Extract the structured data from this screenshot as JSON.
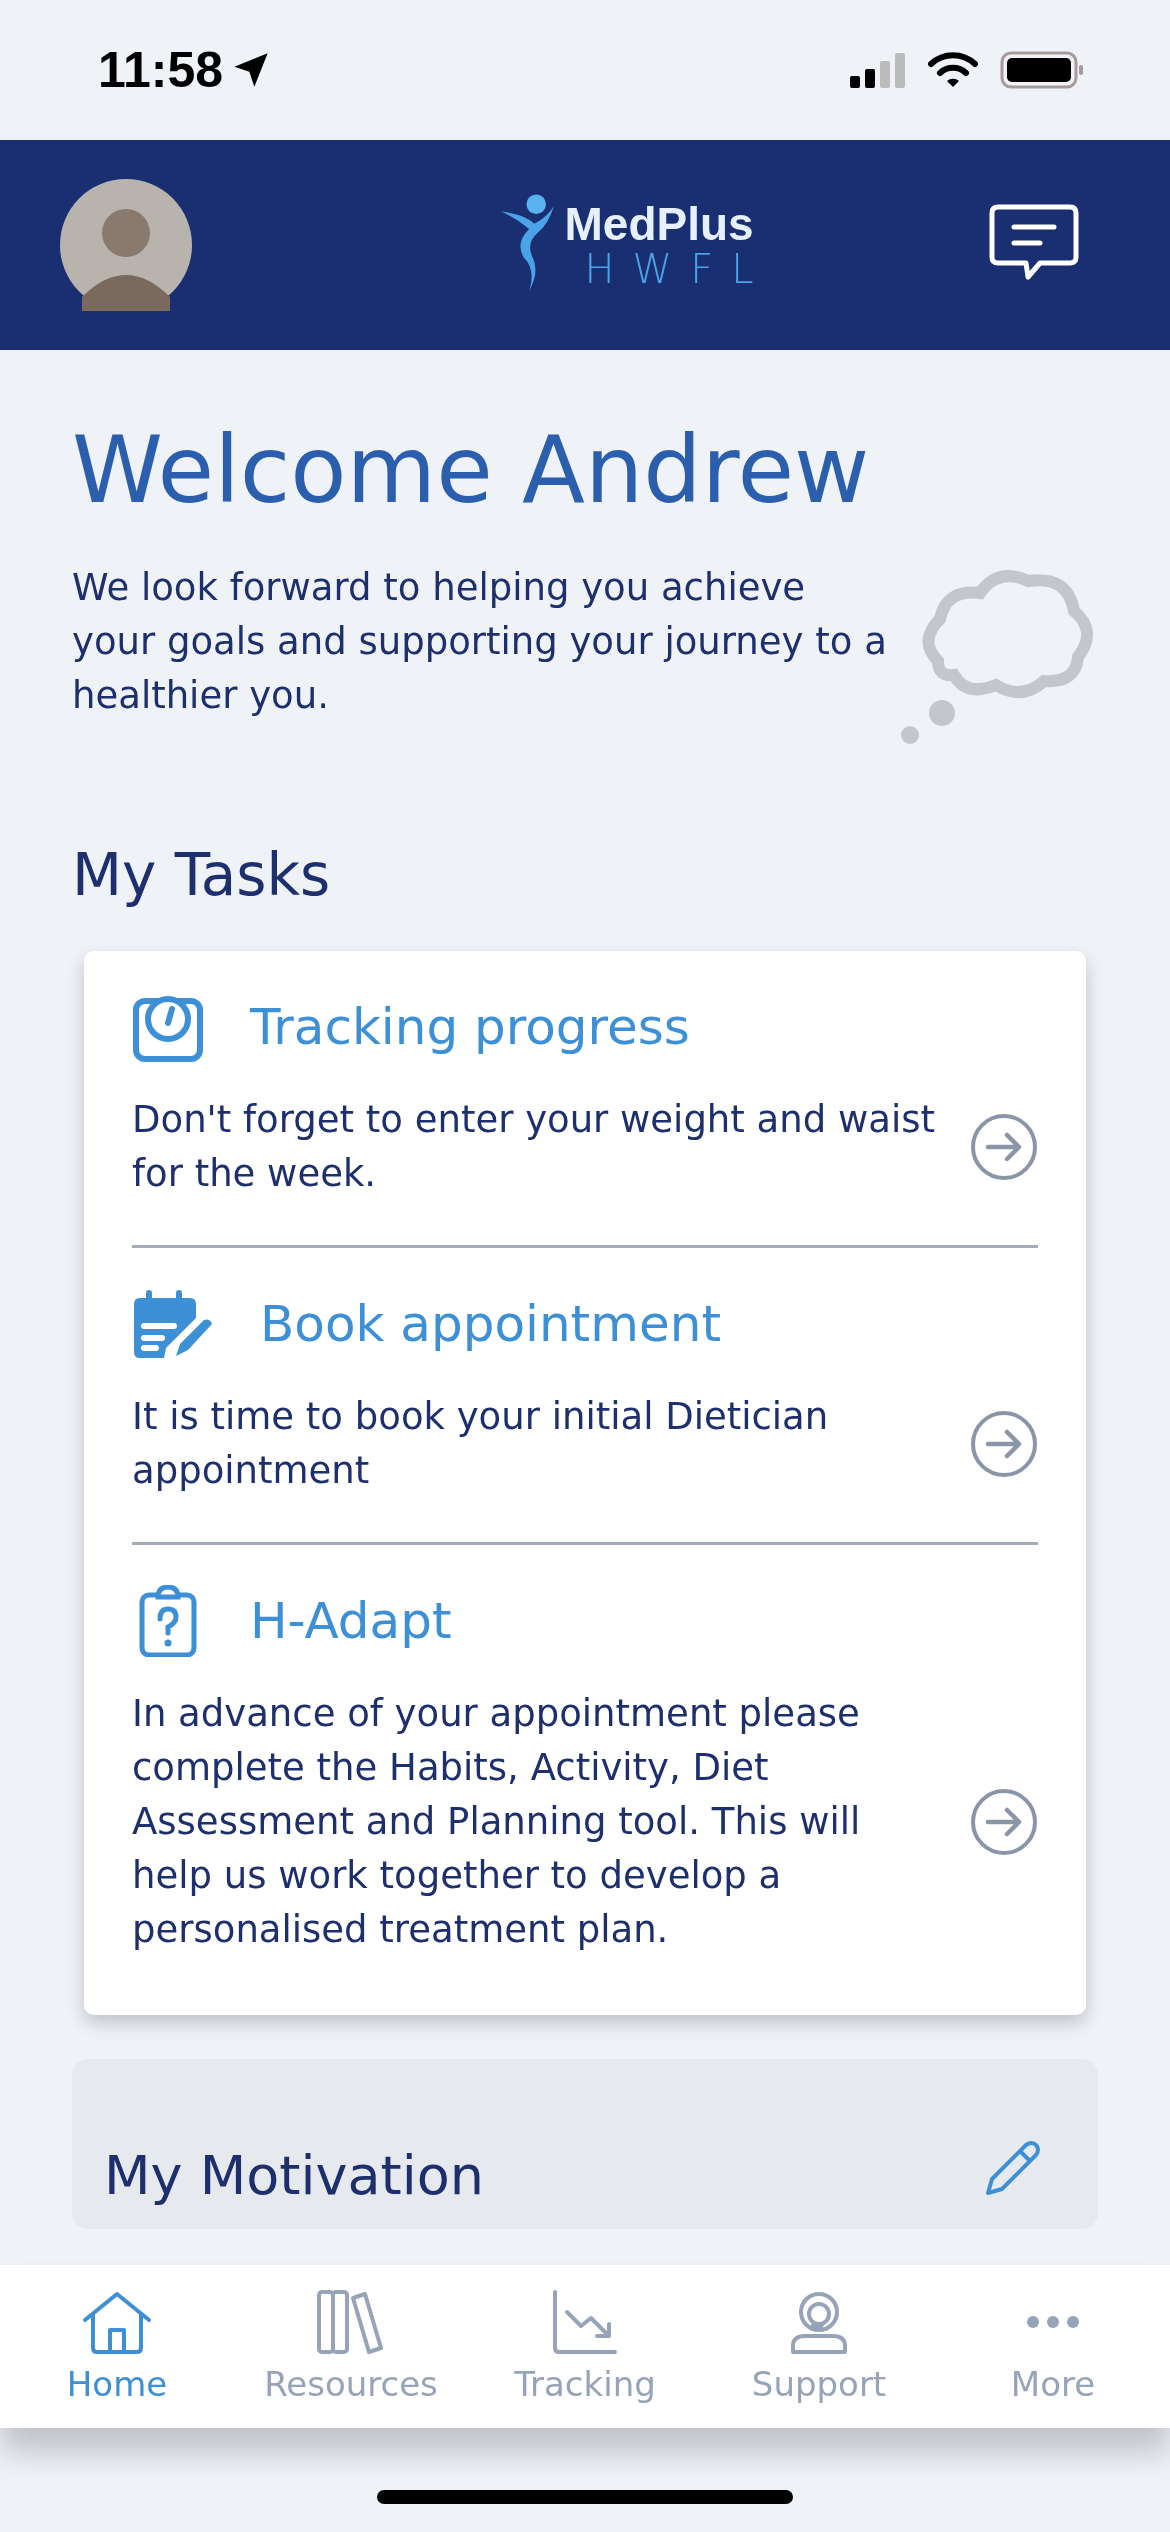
{
  "status_bar": {
    "time": "11:58"
  },
  "header": {
    "logo": {
      "name": "MedPlus",
      "sub": "HWFL"
    }
  },
  "welcome": {
    "title": "Welcome Andrew",
    "text": "We look forward to helping you achieve your goals and supporting your journey to a healthier you."
  },
  "tasks": {
    "title": "My Tasks",
    "items": [
      {
        "kind": "scale",
        "title": "Tracking progress",
        "text": "Don't forget to enter your weight and waist for the week."
      },
      {
        "kind": "calendar",
        "title": "Book appointment",
        "text": "It is time to book your initial Dietician appointment"
      },
      {
        "kind": "clipboard",
        "title": "H-Adapt",
        "text": "In advance of your appointment please complete the Habits, Activity, Diet Assessment and Planning tool. This will help us work together to develop a personalised treatment plan."
      }
    ]
  },
  "motivation": {
    "title": "My Motivation"
  },
  "tab_bar": [
    {
      "kind": "home",
      "label": "Home",
      "selected": true
    },
    {
      "kind": "books",
      "label": "Resources",
      "selected": false
    },
    {
      "kind": "chart",
      "label": "Tracking",
      "selected": false
    },
    {
      "kind": "support",
      "label": "Support",
      "selected": false
    },
    {
      "kind": "more",
      "label": "More",
      "selected": false
    }
  ]
}
